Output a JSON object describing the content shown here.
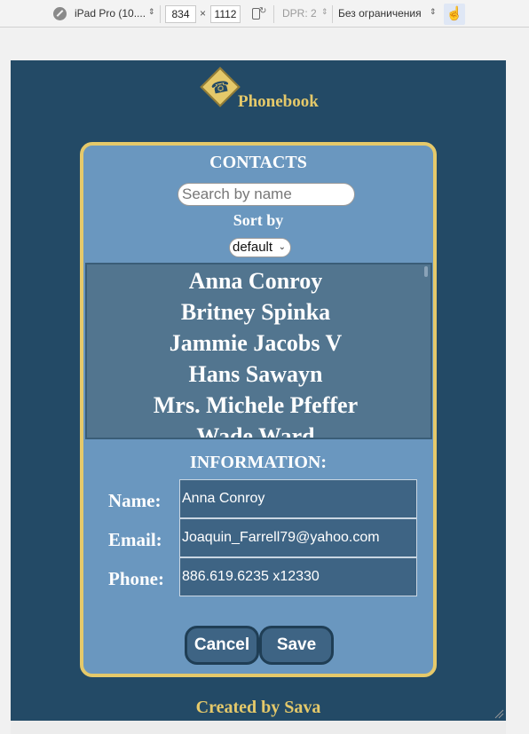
{
  "devtools": {
    "device": "iPad Pro (10....",
    "width": "834",
    "times": "×",
    "height": "1112",
    "dpr": "DPR: 2",
    "throttle": "Без ограничения"
  },
  "app": {
    "title": "Phonebook",
    "footer": "Created by Sava",
    "accent": "#e5c96a",
    "background": "#234a66",
    "card_bg": "#6a97bf"
  },
  "contacts": {
    "title": "CONTACTS",
    "search_placeholder": "Search by name",
    "sort_label": "Sort by",
    "sort_value": "default",
    "items": [
      "Anna Conroy",
      "Britney Spinka",
      "Jammie Jacobs V",
      "Hans Sawayn",
      "Mrs. Michele Pfeffer",
      "Wade Ward"
    ]
  },
  "information": {
    "title": "INFORMATION:",
    "name_label": "Name:",
    "name_value": "Anna Conroy",
    "email_label": "Email:",
    "email_value": "Joaquin_Farrell79@yahoo.com",
    "phone_label": "Phone:",
    "phone_value": "886.619.6235 x12330",
    "cancel_label": "Cancel",
    "save_label": "Save"
  }
}
